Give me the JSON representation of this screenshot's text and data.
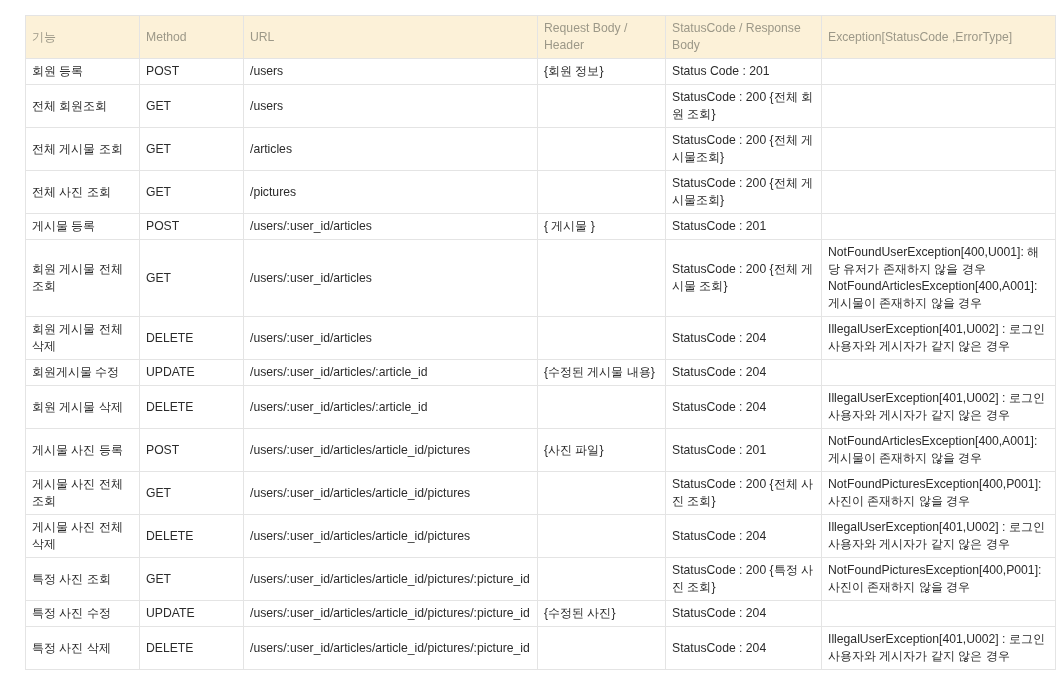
{
  "table": {
    "columns": [
      "기능",
      "Method",
      "URL",
      "Request Body / Header",
      "StatusCode / Response Body",
      "Exception[StatusCode ,ErrorType]"
    ],
    "rows": [
      {
        "feature": "회원 등록",
        "method": "POST",
        "url": "/users",
        "request": "{회원 정보}",
        "response": "Status Code : 201"
      },
      {
        "feature": "전체 회원조회",
        "method": "GET",
        "url": "/users",
        "response": "StatusCode : 200 {전체 회원 조회}"
      },
      {
        "feature": "전체 게시물 조회",
        "method": "GET",
        "url": "/articles",
        "response": "StatusCode : 200 {전체 게시물조회}"
      },
      {
        "feature": "전체 사진 조회",
        "method": "GET",
        "url": "/pictures",
        "response": "StatusCode : 200 {전체 게시물조회}"
      },
      {
        "feature": "게시물 등록",
        "method": "POST",
        "url": "/users/:user_id/articles",
        "request": "{ 게시물 }",
        "response": "StatusCode : 201"
      },
      {
        "feature": "회원 게시물 전체 조회",
        "method": "GET",
        "url": "/users/:user_id/articles",
        "response": "StatusCode : 200 {전체 게시물 조회}",
        "exceptions": [
          "NotFoundUserException[400,U001]: 해당 유저가 존재하지 않을 경우",
          "NotFoundArticlesException[400,A001]: 게시물이 존재하지 않을 경우"
        ]
      },
      {
        "feature": "회원 게시물 전체 삭제",
        "method": "DELETE",
        "url": "/users/:user_id/articles",
        "response": "StatusCode : 204",
        "exceptions": [
          "IllegalUserException[401,U002] : 로그인 사용자와 게시자가 같지 않은 경우"
        ]
      },
      {
        "feature": "회원게시물 수정",
        "method": "UPDATE",
        "url": "/users/:user_id/articles/:article_id",
        "request": "{수정된 게시물 내용}",
        "response": "StatusCode : 204"
      },
      {
        "feature": "회원 게시물 삭제",
        "method": "DELETE",
        "url": "/users/:user_id/articles/:article_id",
        "response": "StatusCode : 204",
        "exceptions": [
          "IllegalUserException[401,U002] : 로그인 사용자와 게시자가 같지 않은 경우"
        ]
      },
      {
        "feature": "게시물 사진 등록",
        "method": "POST",
        "url": "/users/:user_id/articles/article_id/pictures",
        "request": "{사진 파일}",
        "response": "StatusCode : 201",
        "exceptions": [
          "NotFoundArticlesException[400,A001]: 게시물이 존재하지 않을 경우"
        ]
      },
      {
        "feature": "게시물 사진 전체 조회",
        "method": "GET",
        "url": "/users/:user_id/articles/article_id/pictures",
        "response": "StatusCode : 200 {전체 사진 조회}",
        "exceptions": [
          "NotFoundPicturesException[400,P001]: 사진이 존재하지 않을 경우"
        ]
      },
      {
        "feature": "게시물 사진 전체 삭제",
        "method": "DELETE",
        "url": "/users/:user_id/articles/article_id/pictures",
        "response": "StatusCode : 204",
        "exceptions": [
          "IllegalUserException[401,U002] : 로그인 사용자와 게시자가 같지 않은 경우"
        ]
      },
      {
        "feature": "특정 사진 조회",
        "method": "GET",
        "url": "/users/:user_id/articles/article_id/pictures/:picture_id",
        "response": "StatusCode : 200 {특정 사진 조회}",
        "exceptions": [
          "NotFoundPicturesException[400,P001]: 사진이 존재하지 않을 경우"
        ]
      },
      {
        "feature": "특정 사진 수정",
        "method": "UPDATE",
        "url": "/users/:user_id/articles/article_id/pictures/:picture_id",
        "request": "{수정된 사진}",
        "response": "StatusCode : 204"
      },
      {
        "feature": "특정 사진 삭제",
        "method": "DELETE",
        "url": "/users/:user_id/articles/article_id/pictures/:picture_id",
        "response": "StatusCode : 204",
        "exceptions": [
          "IllegalUserException[401,U002] : 로그인 사용자와 게시자가 같지 않은 경우"
        ]
      }
    ]
  }
}
